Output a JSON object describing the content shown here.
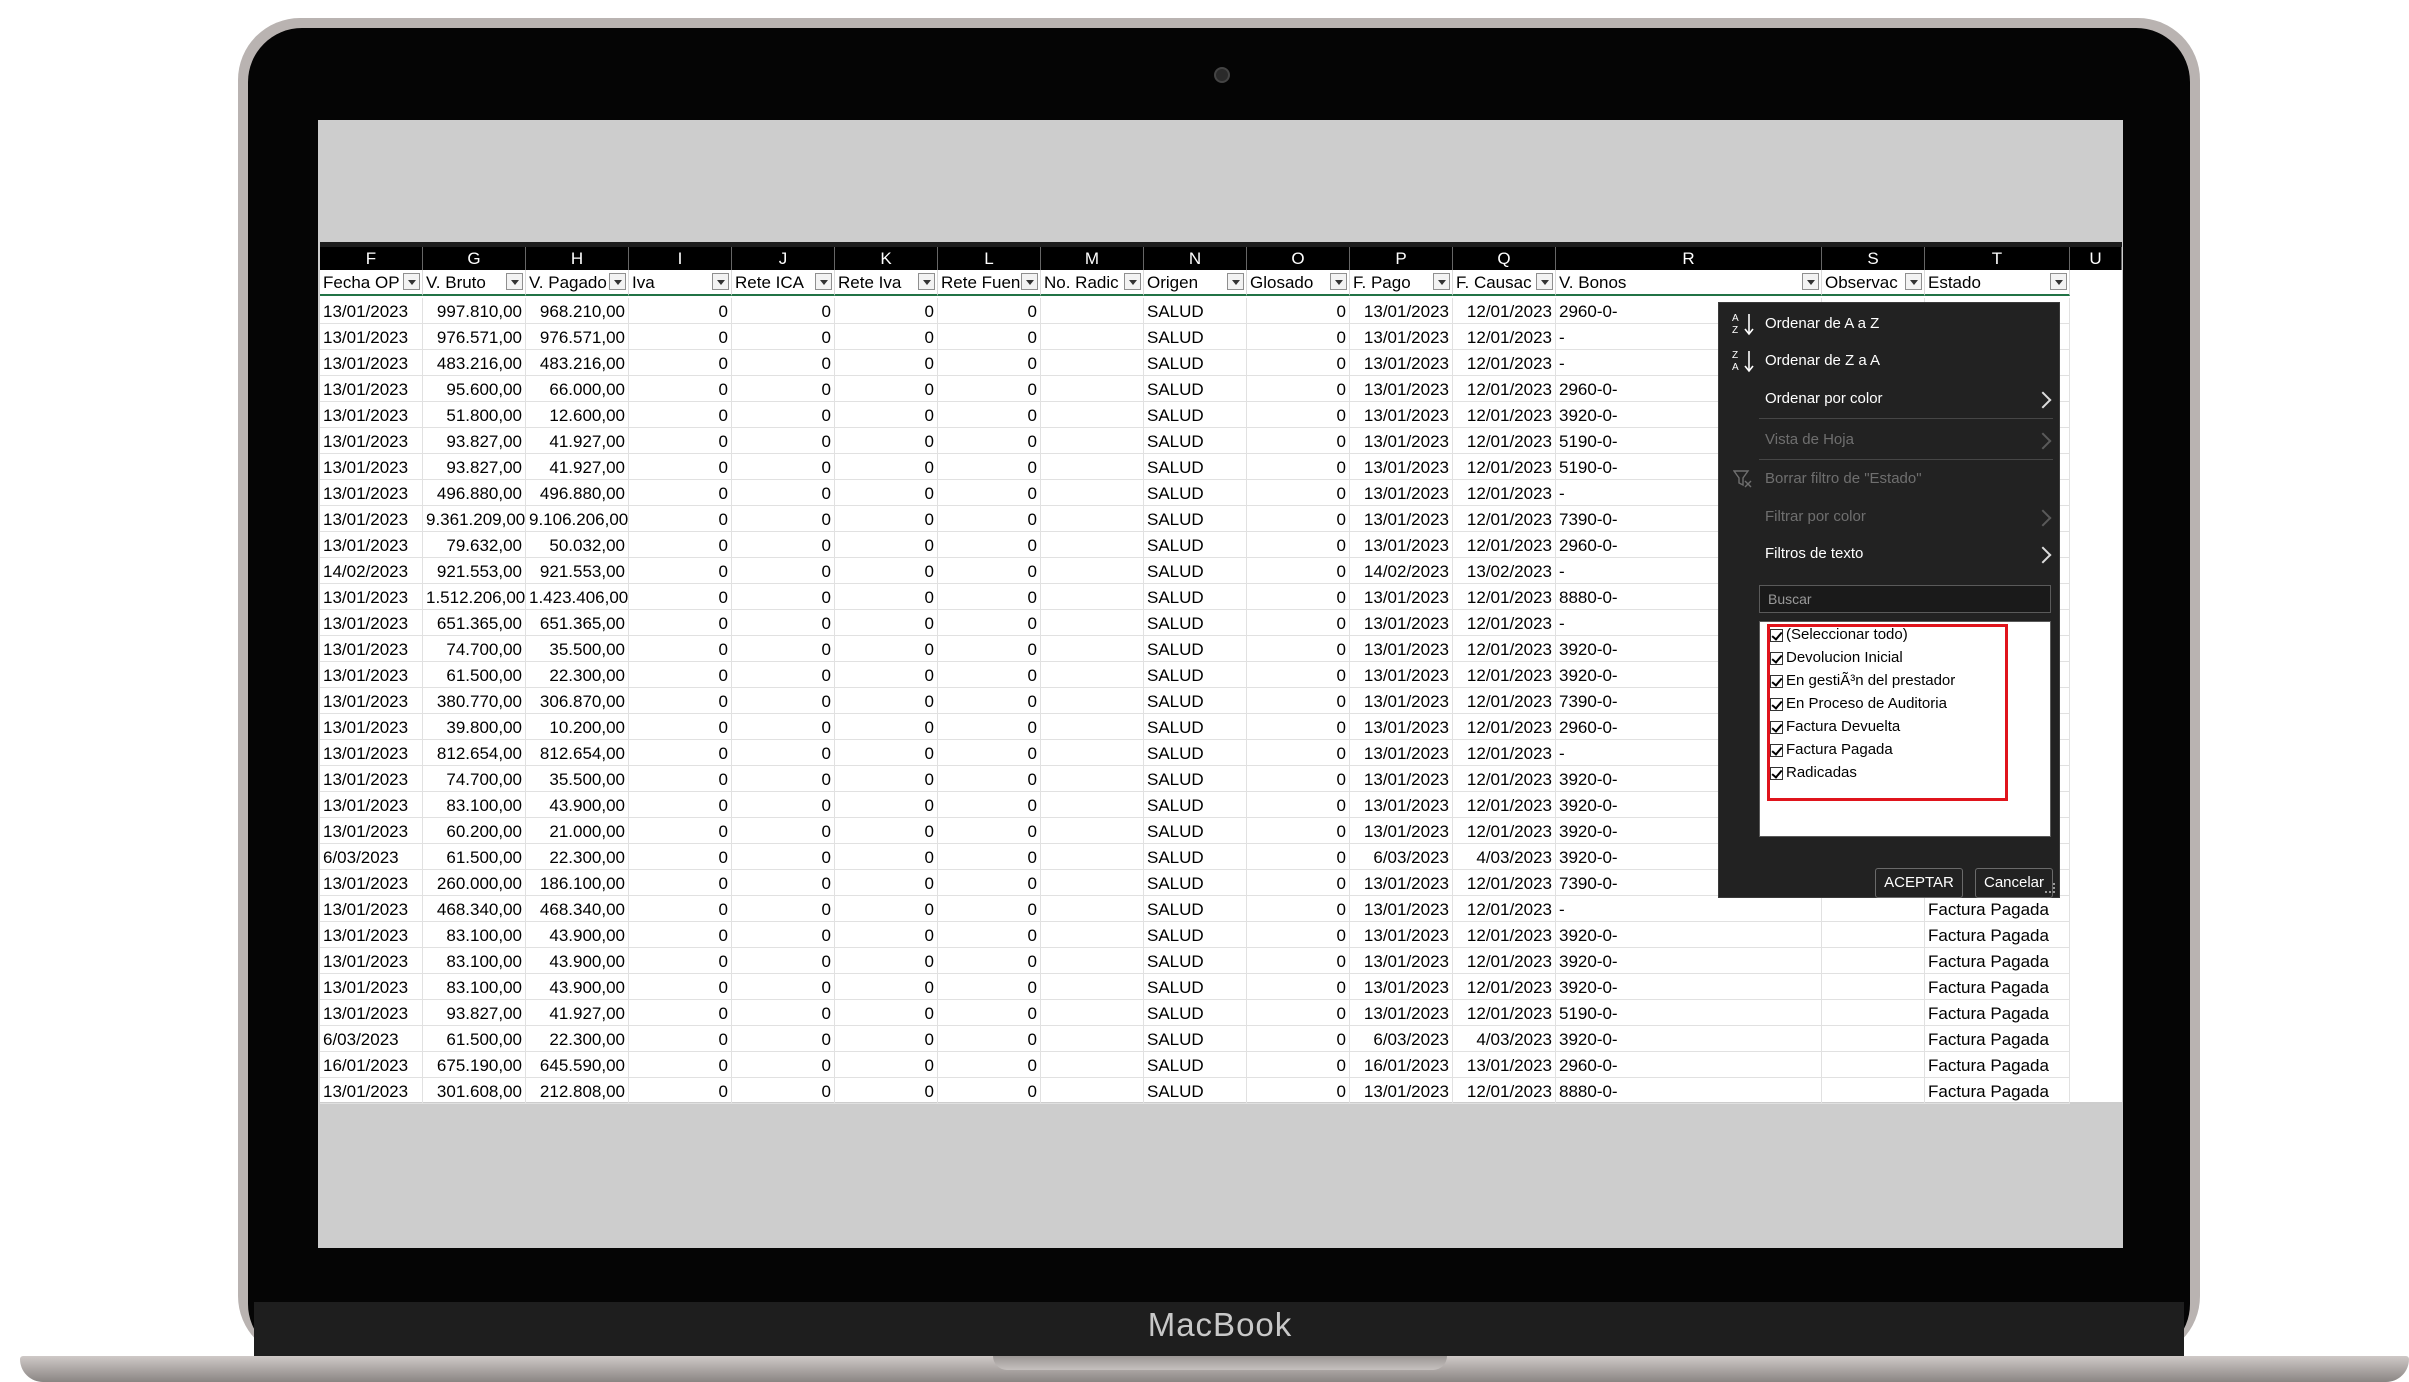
{
  "device": {
    "brand": "MacBook"
  },
  "spreadsheet": {
    "column_letters": [
      "F",
      "G",
      "H",
      "I",
      "J",
      "K",
      "L",
      "M",
      "N",
      "O",
      "P",
      "Q",
      "R",
      "S",
      "T",
      "U"
    ],
    "filter_headers": [
      "Fecha OP",
      "V. Bruto",
      "V. Pagado",
      "Iva",
      "Rete ICA",
      "Rete Iva",
      "Rete Fuen",
      "No. Radic",
      "Origen",
      "Glosado",
      "F. Pago",
      "F. Causac",
      "V. Bonos",
      "Observac",
      "Estado"
    ],
    "rows": [
      [
        "13/01/2023",
        "997.810,00",
        "968.210,00",
        "0",
        "0",
        "0",
        "0",
        "",
        "SALUD",
        "0",
        "13/01/2023",
        "12/01/2023",
        "2960-0-",
        "",
        ""
      ],
      [
        "13/01/2023",
        "976.571,00",
        "976.571,00",
        "0",
        "0",
        "0",
        "0",
        "",
        "SALUD",
        "0",
        "13/01/2023",
        "12/01/2023",
        "-",
        "",
        ""
      ],
      [
        "13/01/2023",
        "483.216,00",
        "483.216,00",
        "0",
        "0",
        "0",
        "0",
        "",
        "SALUD",
        "0",
        "13/01/2023",
        "12/01/2023",
        "-",
        "",
        ""
      ],
      [
        "13/01/2023",
        "95.600,00",
        "66.000,00",
        "0",
        "0",
        "0",
        "0",
        "",
        "SALUD",
        "0",
        "13/01/2023",
        "12/01/2023",
        "2960-0-",
        "",
        ""
      ],
      [
        "13/01/2023",
        "51.800,00",
        "12.600,00",
        "0",
        "0",
        "0",
        "0",
        "",
        "SALUD",
        "0",
        "13/01/2023",
        "12/01/2023",
        "3920-0-",
        "",
        ""
      ],
      [
        "13/01/2023",
        "93.827,00",
        "41.927,00",
        "0",
        "0",
        "0",
        "0",
        "",
        "SALUD",
        "0",
        "13/01/2023",
        "12/01/2023",
        "5190-0-",
        "",
        ""
      ],
      [
        "13/01/2023",
        "93.827,00",
        "41.927,00",
        "0",
        "0",
        "0",
        "0",
        "",
        "SALUD",
        "0",
        "13/01/2023",
        "12/01/2023",
        "5190-0-",
        "",
        ""
      ],
      [
        "13/01/2023",
        "496.880,00",
        "496.880,00",
        "0",
        "0",
        "0",
        "0",
        "",
        "SALUD",
        "0",
        "13/01/2023",
        "12/01/2023",
        "-",
        "",
        ""
      ],
      [
        "13/01/2023",
        "9.361.209,00",
        "9.106.206,00",
        "0",
        "0",
        "0",
        "0",
        "",
        "SALUD",
        "0",
        "13/01/2023",
        "12/01/2023",
        "7390-0-",
        "",
        ""
      ],
      [
        "13/01/2023",
        "79.632,00",
        "50.032,00",
        "0",
        "0",
        "0",
        "0",
        "",
        "SALUD",
        "0",
        "13/01/2023",
        "12/01/2023",
        "2960-0-",
        "",
        ""
      ],
      [
        "14/02/2023",
        "921.553,00",
        "921.553,00",
        "0",
        "0",
        "0",
        "0",
        "",
        "SALUD",
        "0",
        "14/02/2023",
        "13/02/2023",
        "-",
        "",
        ""
      ],
      [
        "13/01/2023",
        "1.512.206,00",
        "1.423.406,00",
        "0",
        "0",
        "0",
        "0",
        "",
        "SALUD",
        "0",
        "13/01/2023",
        "12/01/2023",
        "8880-0-",
        "",
        ""
      ],
      [
        "13/01/2023",
        "651.365,00",
        "651.365,00",
        "0",
        "0",
        "0",
        "0",
        "",
        "SALUD",
        "0",
        "13/01/2023",
        "12/01/2023",
        "-",
        "",
        ""
      ],
      [
        "13/01/2023",
        "74.700,00",
        "35.500,00",
        "0",
        "0",
        "0",
        "0",
        "",
        "SALUD",
        "0",
        "13/01/2023",
        "12/01/2023",
        "3920-0-",
        "",
        ""
      ],
      [
        "13/01/2023",
        "61.500,00",
        "22.300,00",
        "0",
        "0",
        "0",
        "0",
        "",
        "SALUD",
        "0",
        "13/01/2023",
        "12/01/2023",
        "3920-0-",
        "",
        ""
      ],
      [
        "13/01/2023",
        "380.770,00",
        "306.870,00",
        "0",
        "0",
        "0",
        "0",
        "",
        "SALUD",
        "0",
        "13/01/2023",
        "12/01/2023",
        "7390-0-",
        "",
        ""
      ],
      [
        "13/01/2023",
        "39.800,00",
        "10.200,00",
        "0",
        "0",
        "0",
        "0",
        "",
        "SALUD",
        "0",
        "13/01/2023",
        "12/01/2023",
        "2960-0-",
        "",
        ""
      ],
      [
        "13/01/2023",
        "812.654,00",
        "812.654,00",
        "0",
        "0",
        "0",
        "0",
        "",
        "SALUD",
        "0",
        "13/01/2023",
        "12/01/2023",
        "-",
        "",
        ""
      ],
      [
        "13/01/2023",
        "74.700,00",
        "35.500,00",
        "0",
        "0",
        "0",
        "0",
        "",
        "SALUD",
        "0",
        "13/01/2023",
        "12/01/2023",
        "3920-0-",
        "",
        ""
      ],
      [
        "13/01/2023",
        "83.100,00",
        "43.900,00",
        "0",
        "0",
        "0",
        "0",
        "",
        "SALUD",
        "0",
        "13/01/2023",
        "12/01/2023",
        "3920-0-",
        "",
        ""
      ],
      [
        "13/01/2023",
        "60.200,00",
        "21.000,00",
        "0",
        "0",
        "0",
        "0",
        "",
        "SALUD",
        "0",
        "13/01/2023",
        "12/01/2023",
        "3920-0-",
        "",
        ""
      ],
      [
        "6/03/2023",
        "61.500,00",
        "22.300,00",
        "0",
        "0",
        "0",
        "0",
        "",
        "SALUD",
        "0",
        "6/03/2023",
        "4/03/2023",
        "3920-0-",
        "",
        ""
      ],
      [
        "13/01/2023",
        "260.000,00",
        "186.100,00",
        "0",
        "0",
        "0",
        "0",
        "",
        "SALUD",
        "0",
        "13/01/2023",
        "12/01/2023",
        "7390-0-",
        "",
        ""
      ],
      [
        "13/01/2023",
        "468.340,00",
        "468.340,00",
        "0",
        "0",
        "0",
        "0",
        "",
        "SALUD",
        "0",
        "13/01/2023",
        "12/01/2023",
        "-",
        "",
        "Factura Pagada"
      ],
      [
        "13/01/2023",
        "83.100,00",
        "43.900,00",
        "0",
        "0",
        "0",
        "0",
        "",
        "SALUD",
        "0",
        "13/01/2023",
        "12/01/2023",
        "3920-0-",
        "",
        "Factura Pagada"
      ],
      [
        "13/01/2023",
        "83.100,00",
        "43.900,00",
        "0",
        "0",
        "0",
        "0",
        "",
        "SALUD",
        "0",
        "13/01/2023",
        "12/01/2023",
        "3920-0-",
        "",
        "Factura Pagada"
      ],
      [
        "13/01/2023",
        "83.100,00",
        "43.900,00",
        "0",
        "0",
        "0",
        "0",
        "",
        "SALUD",
        "0",
        "13/01/2023",
        "12/01/2023",
        "3920-0-",
        "",
        "Factura Pagada"
      ],
      [
        "13/01/2023",
        "93.827,00",
        "41.927,00",
        "0",
        "0",
        "0",
        "0",
        "",
        "SALUD",
        "0",
        "13/01/2023",
        "12/01/2023",
        "5190-0-",
        "",
        "Factura Pagada"
      ],
      [
        "6/03/2023",
        "61.500,00",
        "22.300,00",
        "0",
        "0",
        "0",
        "0",
        "",
        "SALUD",
        "0",
        "6/03/2023",
        "4/03/2023",
        "3920-0-",
        "",
        "Factura Pagada"
      ],
      [
        "16/01/2023",
        "675.190,00",
        "645.590,00",
        "0",
        "0",
        "0",
        "0",
        "",
        "SALUD",
        "0",
        "16/01/2023",
        "13/01/2023",
        "2960-0-",
        "",
        "Factura Pagada"
      ],
      [
        "13/01/2023",
        "301.608,00",
        "212.808,00",
        "0",
        "0",
        "0",
        "0",
        "",
        "SALUD",
        "0",
        "13/01/2023",
        "12/01/2023",
        "8880-0-",
        "",
        "Factura Pagada"
      ]
    ]
  },
  "filter_menu": {
    "sort_az": "Ordenar de A a Z",
    "sort_za": "Ordenar de Z a A",
    "sort_by_color": "Ordenar por color",
    "sheet_view": "Vista de Hoja",
    "clear_filter": "Borrar filtro de \"Estado\"",
    "filter_by_color": "Filtrar por color",
    "text_filters": "Filtros de texto",
    "search_placeholder": "Buscar",
    "items": [
      {
        "label": "(Seleccionar todo)",
        "checked": true
      },
      {
        "label": "Devolucion Inicial",
        "checked": true
      },
      {
        "label": "En gestiÃ³n del prestador",
        "checked": true
      },
      {
        "label": "En Proceso de Auditoria",
        "checked": true
      },
      {
        "label": "Factura Devuelta",
        "checked": true
      },
      {
        "label": "Factura Pagada",
        "checked": true
      },
      {
        "label": "Radicadas",
        "checked": true
      }
    ],
    "ok_label": "ACEPTAR",
    "cancel_label": "Cancelar",
    "highlight_color": "#e0141c"
  }
}
